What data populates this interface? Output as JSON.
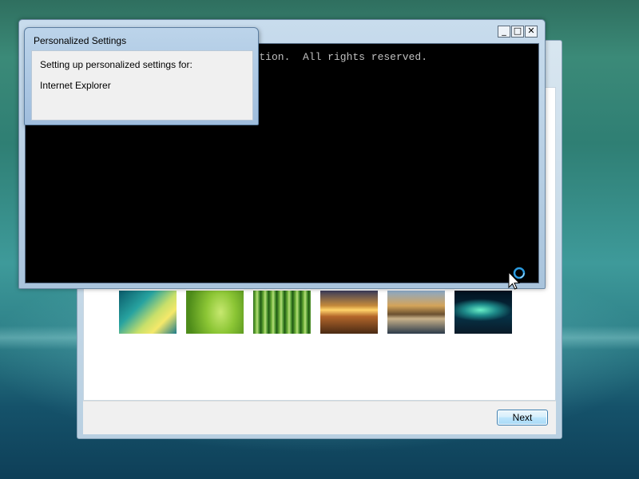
{
  "popup": {
    "title": "Personalized Settings",
    "line1": "Setting up personalized settings for:",
    "line2": "Internet Explorer"
  },
  "console": {
    "visible_text": "tion.  All rights reserved.",
    "controls": {
      "minimize": "_",
      "maximize": "□",
      "close": "✕"
    }
  },
  "wizard": {
    "next_label": "Next",
    "wallpapers": [
      "Vista aurora",
      "green leaf",
      "bamboo",
      "sunset grass",
      "lake mountain",
      "northern lights"
    ]
  },
  "cursor": {
    "icon": "busy-cursor-icon"
  }
}
